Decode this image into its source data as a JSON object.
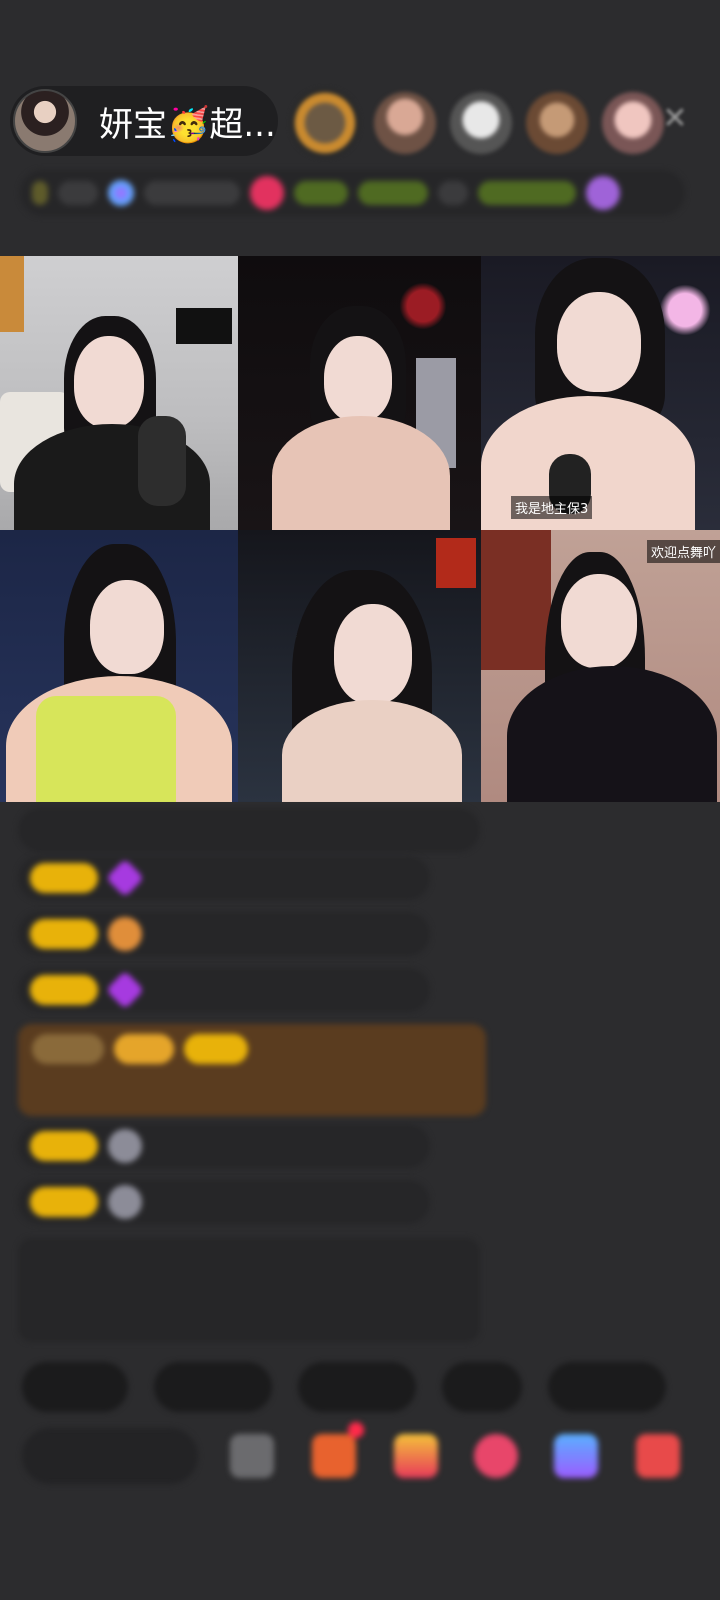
{
  "host": {
    "name": "妍宝🥳超..."
  },
  "topbar": {
    "close_icon": "close-icon"
  },
  "info_strip": {
    "chips": [
      "",
      "",
      "",
      "",
      "",
      "",
      ""
    ]
  },
  "video_grid": {
    "tiles": [
      {
        "label": ""
      },
      {
        "label": ""
      },
      {
        "label": "我是地主保3"
      },
      {
        "label": ""
      },
      {
        "label": ""
      },
      {
        "label": "欢迎点舞吖"
      }
    ]
  },
  "chat": {
    "messages": [
      "",
      "",
      "",
      "",
      "",
      "",
      ""
    ]
  },
  "quick_replies": [
    "",
    "",
    "",
    "",
    ""
  ],
  "bottom_bar": {
    "input_placeholder": "",
    "icons": [
      "more-icon",
      "gift-box-icon",
      "treasure-icon",
      "heart-gift-icon",
      "share-icon",
      "gift-icon"
    ]
  }
}
